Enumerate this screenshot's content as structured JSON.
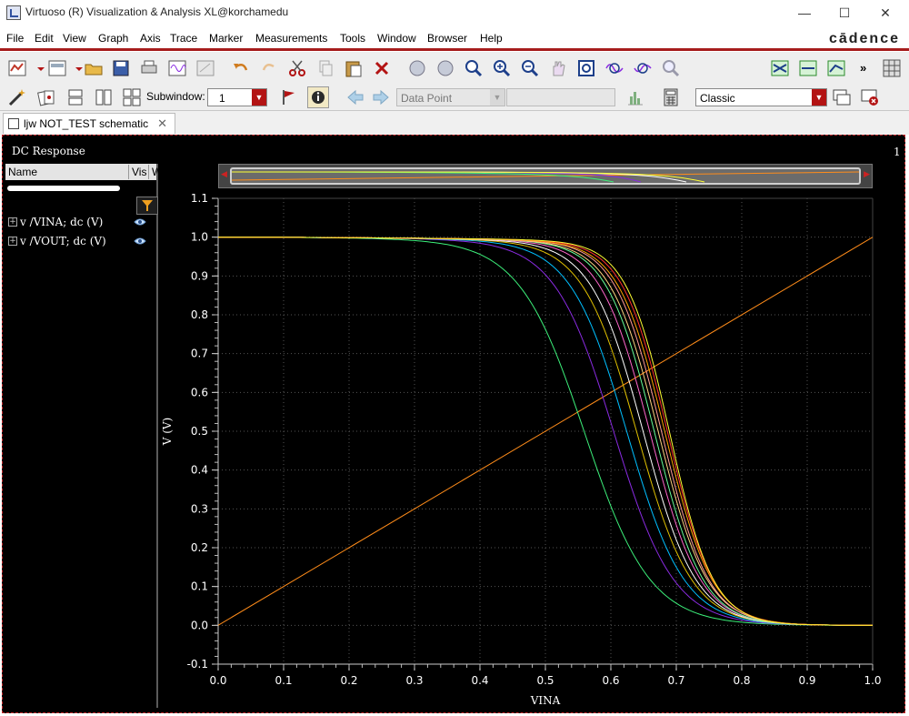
{
  "window": {
    "title": "Virtuoso (R) Visualization & Analysis XL@korchamedu",
    "minimize": "—",
    "maximize": "☐",
    "close": "✕"
  },
  "menu": {
    "items": [
      "File",
      "Edit",
      "View",
      "Graph",
      "Axis",
      "Trace",
      "Marker",
      "Measurements",
      "Tools",
      "Window",
      "Browser",
      "Help"
    ],
    "brand": "cādence"
  },
  "toolbar1": {
    "family_select": "family",
    "overflow": "»"
  },
  "toolbar2": {
    "subwindow_label": "Subwindow:",
    "subwindow_value": "1",
    "marker_select": "Data Point",
    "marker_value": "",
    "style_select": "Classic"
  },
  "tab": {
    "label": "ljw NOT_TEST schematic",
    "close": "✕"
  },
  "panel": {
    "title": "DC Response",
    "subwindow_number": "1"
  },
  "trace_list": {
    "columns": [
      "Name",
      "Vis",
      "W"
    ],
    "items": [
      {
        "name": "v /VINA; dc (V)"
      },
      {
        "name": "v /VOUT; dc (V)"
      }
    ]
  },
  "colors": {
    "accent": "#b31313",
    "plot_bg": "#000000",
    "border": "#c4282c"
  },
  "chart_data": {
    "type": "line",
    "xlabel": "VINA",
    "ylabel": "V (V)",
    "xlim": [
      0.0,
      1.0
    ],
    "ylim": [
      -0.1,
      1.1
    ],
    "x_ticks": [
      "0.0",
      "0.1",
      "0.2",
      "0.3",
      "0.4",
      "0.5",
      "0.6",
      "0.7",
      "0.8",
      "0.9",
      "1.0"
    ],
    "y_ticks": [
      "1.1",
      "1.0",
      "0.9",
      "0.8",
      "0.7",
      "0.6",
      "0.5",
      "0.4",
      "0.3",
      "0.2",
      "0.1",
      "0.0",
      "-0.1"
    ],
    "grid": true,
    "legend": "none",
    "series": [
      {
        "color": "#ff8c1a",
        "x": [
          0.0,
          1.0
        ],
        "y": [
          0.0,
          1.0
        ]
      },
      {
        "color": "#3cf07a",
        "midpoint": 0.56,
        "slope": 20,
        "x": [
          0.0,
          0.3,
          0.4,
          0.5,
          0.53,
          0.56,
          0.6,
          0.65,
          0.7,
          0.75,
          0.8,
          0.9,
          1.0
        ],
        "y": [
          1.0,
          0.995,
          0.98,
          0.9,
          0.8,
          0.5,
          0.3,
          0.13,
          0.05,
          0.02,
          0.01,
          0.0,
          0.0
        ]
      },
      {
        "color": "#8a2be2",
        "midpoint": 0.605,
        "slope": 22,
        "x": [
          0.0,
          0.4,
          0.5,
          0.57,
          0.6,
          0.605,
          0.62,
          0.65,
          0.7,
          0.75,
          0.8,
          0.9,
          1.0
        ],
        "y": [
          1.0,
          0.99,
          0.97,
          0.85,
          0.6,
          0.5,
          0.42,
          0.27,
          0.1,
          0.04,
          0.01,
          0.0,
          0.0
        ]
      },
      {
        "color": "#00bfff",
        "midpoint": 0.625,
        "slope": 23,
        "x": [
          0.0,
          0.5,
          0.6,
          0.625,
          0.65,
          0.7,
          0.8,
          0.9,
          1.0
        ],
        "y": [
          1.0,
          0.985,
          0.9,
          0.5,
          0.36,
          0.15,
          0.02,
          0.0,
          0.0
        ]
      },
      {
        "color": "#e0c000",
        "midpoint": 0.64,
        "slope": 24,
        "x": [
          0.0,
          0.5,
          0.6,
          0.64,
          0.66,
          0.7,
          0.8,
          0.9,
          1.0
        ],
        "y": [
          1.0,
          0.985,
          0.93,
          0.5,
          0.38,
          0.19,
          0.02,
          0.0,
          0.0
        ]
      },
      {
        "color": "#ffffff",
        "midpoint": 0.65,
        "slope": 25,
        "x": [
          0.0,
          0.5,
          0.6,
          0.65,
          0.67,
          0.7,
          0.8,
          0.9,
          1.0
        ],
        "y": [
          1.0,
          0.985,
          0.95,
          0.5,
          0.38,
          0.22,
          0.02,
          0.0,
          0.0
        ]
      },
      {
        "color": "#ff66cc",
        "midpoint": 0.66,
        "slope": 26,
        "x": [
          0.0,
          0.5,
          0.6,
          0.66,
          0.68,
          0.7,
          0.8,
          0.9,
          1.0
        ],
        "y": [
          1.0,
          0.985,
          0.96,
          0.5,
          0.37,
          0.26,
          0.02,
          0.0,
          0.0
        ]
      },
      {
        "color": "#66ff99",
        "midpoint": 0.667,
        "slope": 27,
        "x": [
          0.0,
          0.5,
          0.6,
          0.667,
          0.69,
          0.72,
          0.8,
          0.9,
          1.0
        ],
        "y": [
          1.0,
          0.985,
          0.965,
          0.5,
          0.35,
          0.2,
          0.02,
          0.0,
          0.0
        ]
      },
      {
        "color": "#ffd27f",
        "midpoint": 0.673,
        "slope": 27,
        "x": [
          0.0,
          0.5,
          0.6,
          0.673,
          0.69,
          0.72,
          0.8,
          0.9,
          1.0
        ],
        "y": [
          1.0,
          0.985,
          0.967,
          0.5,
          0.39,
          0.22,
          0.02,
          0.0,
          0.0
        ]
      },
      {
        "color": "#ff9999",
        "midpoint": 0.678,
        "slope": 28,
        "x": [
          0.0,
          0.5,
          0.6,
          0.678,
          0.7,
          0.72,
          0.8,
          0.9,
          1.0
        ],
        "y": [
          1.0,
          0.985,
          0.97,
          0.5,
          0.35,
          0.24,
          0.02,
          0.0,
          0.0
        ]
      },
      {
        "color": "#ffa500",
        "midpoint": 0.683,
        "slope": 28,
        "x": [
          0.0,
          0.5,
          0.6,
          0.683,
          0.7,
          0.72,
          0.8,
          0.9,
          1.0
        ],
        "y": [
          1.0,
          0.985,
          0.972,
          0.5,
          0.39,
          0.26,
          0.02,
          0.0,
          0.0
        ]
      },
      {
        "color": "#ff3030",
        "midpoint": 0.687,
        "slope": 29,
        "x": [
          0.0,
          0.5,
          0.6,
          0.687,
          0.7,
          0.72,
          0.8,
          0.9,
          1.0
        ],
        "y": [
          1.0,
          0.985,
          0.975,
          0.5,
          0.41,
          0.28,
          0.02,
          0.0,
          0.0
        ]
      },
      {
        "color": "#ffff33",
        "midpoint": 0.69,
        "slope": 30,
        "x": [
          0.0,
          0.5,
          0.6,
          0.69,
          0.71,
          0.73,
          0.8,
          0.9,
          1.0
        ],
        "y": [
          1.0,
          0.985,
          0.978,
          0.5,
          0.35,
          0.23,
          0.02,
          0.0,
          0.0
        ]
      }
    ]
  }
}
